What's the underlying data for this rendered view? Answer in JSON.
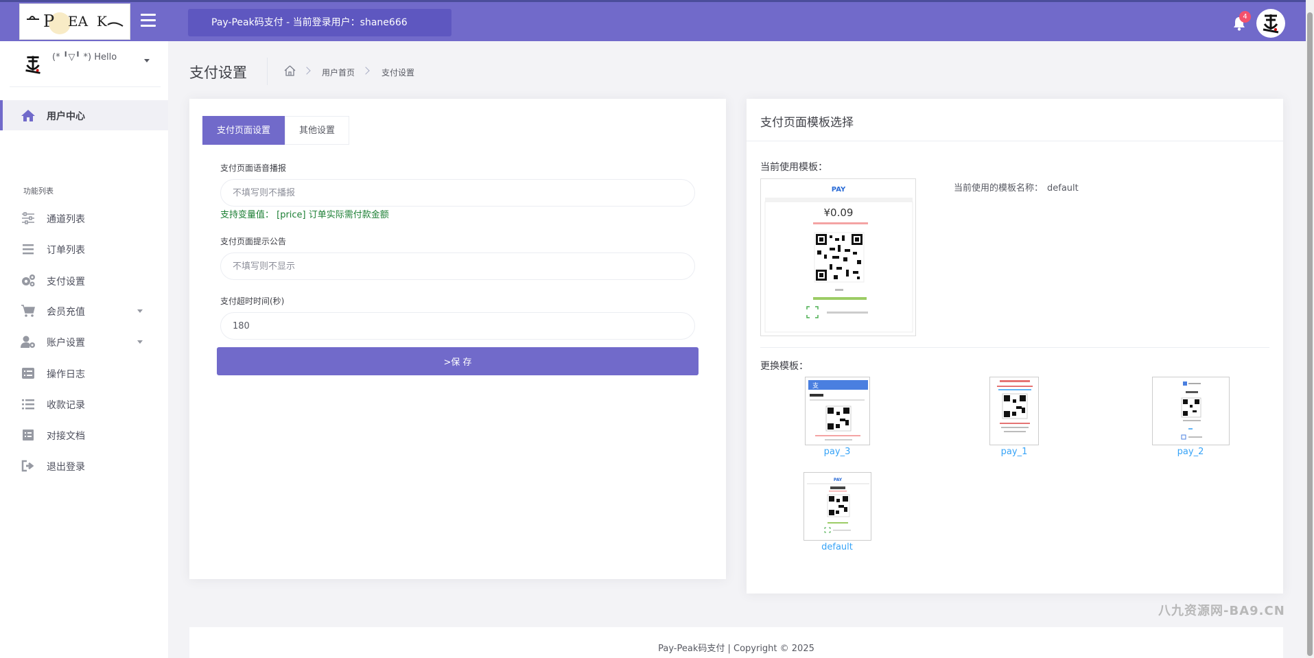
{
  "header": {
    "title": "Pay-Peak码支付 - 当前登录用户：shane666",
    "notification_count": "4",
    "logo_text": "P EA K"
  },
  "sidebar": {
    "greeting": "(* ╹▽╹ *) Hello",
    "section_label": "功能列表",
    "items": [
      {
        "label": "用户中心",
        "icon": "home-icon"
      },
      {
        "label": "通道列表",
        "icon": "sliders-icon"
      },
      {
        "label": "订单列表",
        "icon": "list-icon"
      },
      {
        "label": "支付设置",
        "icon": "gears-icon"
      },
      {
        "label": "会员充值",
        "icon": "cart-icon"
      },
      {
        "label": "账户设置",
        "icon": "user-gear-icon"
      },
      {
        "label": "操作日志",
        "icon": "log-icon"
      },
      {
        "label": "收款记录",
        "icon": "list-lines-icon"
      },
      {
        "label": "对接文档",
        "icon": "doc-icon"
      },
      {
        "label": "退出登录",
        "icon": "logout-icon"
      }
    ]
  },
  "page": {
    "title": "支付设置",
    "breadcrumb": [
      "用户首页",
      "支付设置"
    ]
  },
  "form": {
    "tabs": [
      "支付页面设置",
      "其他设置"
    ],
    "voice_label": "支付页面语音播报",
    "voice_placeholder": "不填写则不播报",
    "voice_help": "支持变量值： [price] 订单实际需付款金额",
    "notice_label": "支付页面提示公告",
    "notice_placeholder": "不填写则不显示",
    "timeout_label": "支付超时时间(秒)",
    "timeout_value": "180",
    "save_label": ">保 存"
  },
  "templates": {
    "panel_title": "支付页面模板选择",
    "current_label": "当前使用模板：",
    "current_name_label": "当前使用的模板名称：",
    "current_name": "default",
    "change_label": "更换模板：",
    "preview_price": "¥0.09",
    "options": [
      "pay_3",
      "pay_1",
      "pay_2",
      "default"
    ]
  },
  "watermark": "八九资源网-BA9.CN",
  "footer": "Pay-Peak码支付  |  Copyright © 2025",
  "colors": {
    "accent": "#716aca",
    "badge": "#f4516c",
    "help_green": "#1c7f34",
    "link": "#36a3f7"
  }
}
